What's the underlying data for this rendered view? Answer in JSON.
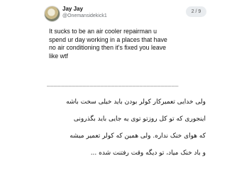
{
  "user": {
    "name": "Jay Jay",
    "handle": "@Onemansidekick1"
  },
  "page_counter": "2 / 9",
  "tweet_lines": [
    "It sucks to be an air cooler repairman u",
    "spend ur day working in a places that have",
    "no air conditioning then it's fixed you leave",
    "like wtf"
  ],
  "divider": "_____________________________________",
  "persian_lines": [
    "ولی خدایی تعمیرکار کولر بودن باید خیلی سخت باشه",
    "اینجوری که تو کل روزتو توی یه جایی باید بگذرونی",
    "که هوای خنک نداره. ولی همین که کولر تعمیر میشه",
    "و باد خنک میاد، تو دیگه وقت رفتنت شده ..."
  ]
}
